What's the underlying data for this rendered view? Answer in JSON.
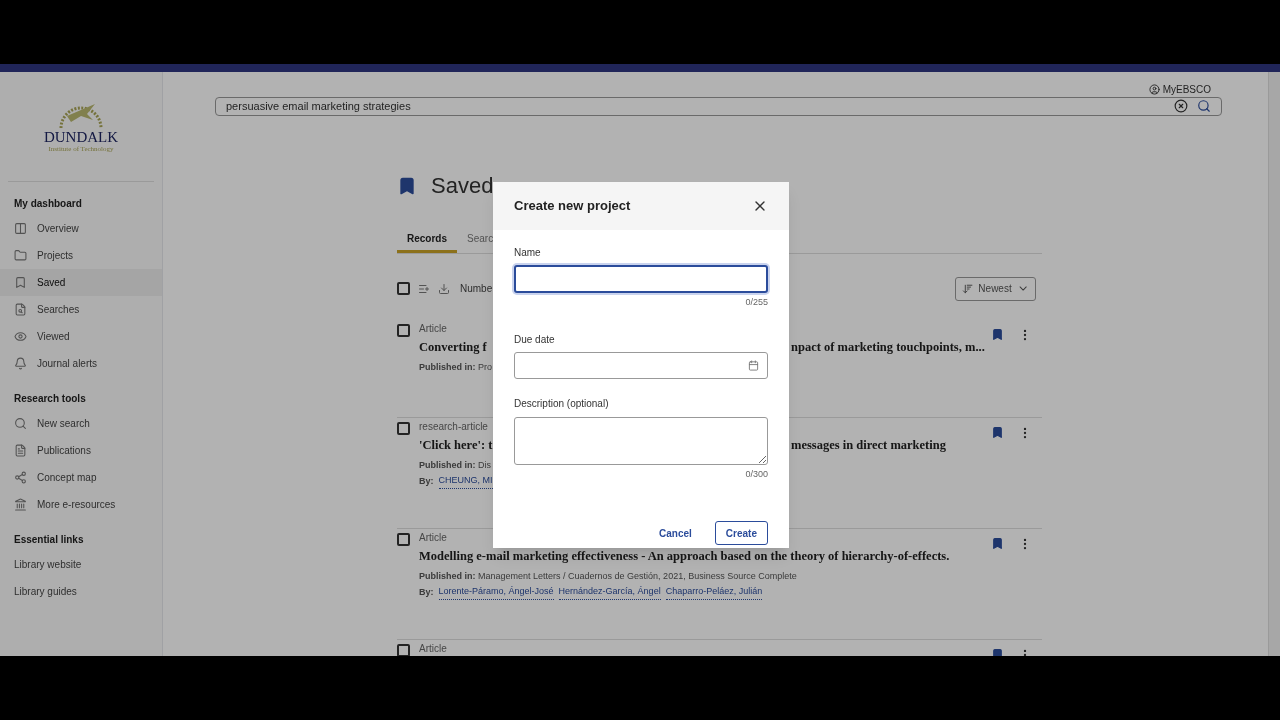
{
  "account": {
    "label": "MyEBSCO"
  },
  "logo": {
    "name": "DUNDALK",
    "subtitle": "Institute of Technology"
  },
  "search": {
    "value": "persuasive email marketing strategies"
  },
  "sidebar": {
    "sections": [
      {
        "heading": "My dashboard",
        "items": [
          {
            "label": "Overview",
            "selected": false
          },
          {
            "label": "Projects",
            "selected": false
          },
          {
            "label": "Saved",
            "selected": true
          },
          {
            "label": "Searches",
            "selected": false
          },
          {
            "label": "Viewed",
            "selected": false
          },
          {
            "label": "Journal alerts",
            "selected": false
          }
        ]
      },
      {
        "heading": "Research tools",
        "items": [
          {
            "label": "New search",
            "selected": false
          },
          {
            "label": "Publications",
            "selected": false
          },
          {
            "label": "Concept map",
            "selected": false
          },
          {
            "label": "More e-resources",
            "selected": false
          }
        ]
      },
      {
        "heading": "Essential links",
        "items": [
          {
            "label": "Library website",
            "selected": false
          },
          {
            "label": "Library guides",
            "selected": false
          }
        ]
      }
    ]
  },
  "page_title": "Saved",
  "tabs": [
    {
      "label": "Records",
      "selected": true
    },
    {
      "label": "Searc",
      "selected": false
    }
  ],
  "toolbar": {
    "select_all": {
      "checked": false
    },
    "label": "Numbe",
    "sort": "Newest"
  },
  "records": [
    {
      "type": "Article",
      "title_left": "Converting f",
      "title_right": "npact of marketing touchpoints, m...",
      "published": "**Published in:** Pro",
      "checked": false,
      "bookmarked": true
    },
    {
      "type": "research-article",
      "title_left": "'Click here': t",
      "title_right": "messages in direct marketing",
      "published": "**Published in:** Dis",
      "by_label": "By:",
      "authors": [
        "CHEUNG, MI"
      ],
      "checked": false,
      "bookmarked": true
    },
    {
      "type": "Article",
      "title_left": "Modelling e-mail marketing effectiveness - An approach based on the theory of hierarchy-of-effects.",
      "published": "**Published in:** Management Letters / Cuadernos de Gestión, 2021, Business Source Complete",
      "by_label": "By:",
      "authors": [
        "Lorente-Páramo, Ángel-José",
        "Hernández-García, Ángel",
        "Chaparro-Peláez, Julián"
      ],
      "checked": false,
      "bookmarked": true
    },
    {
      "type": "Article",
      "checked": false,
      "bookmarked": true
    }
  ],
  "dialog": {
    "title": "Create new project",
    "name_field": {
      "label": "Name",
      "counter": "0/255",
      "focused": true
    },
    "due_field": {
      "label": "Due date"
    },
    "description_field": {
      "label": "Description (optional)",
      "counter": "0/300"
    },
    "buttons": [
      {
        "label": "Cancel",
        "kind": "text"
      },
      {
        "label": "Create",
        "kind": "outlined"
      }
    ]
  }
}
